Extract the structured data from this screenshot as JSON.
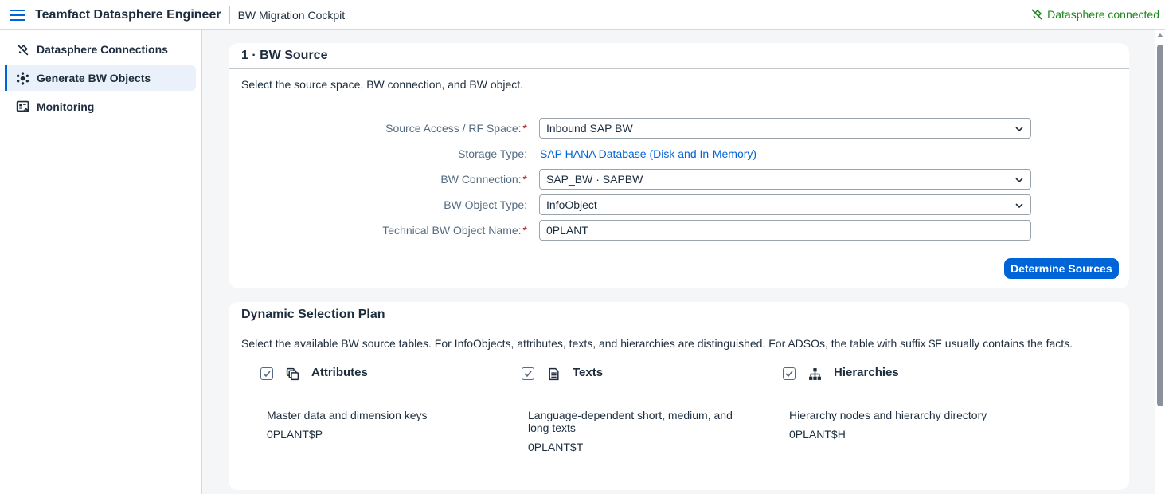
{
  "shell": {
    "title": "Teamfact Datasphere Engineer",
    "subtitle": "BW Migration Cockpit",
    "status": "Datasphere connected",
    "status_color": "#188918",
    "menu_icon": "hamburger-menu-icon"
  },
  "sidebar": {
    "items": [
      {
        "label": "Datasphere Connections",
        "icon": "connection-plug-icon",
        "active": false
      },
      {
        "label": "Generate BW Objects",
        "icon": "cube-network-icon",
        "active": true
      },
      {
        "label": "Monitoring",
        "icon": "monitor-dashboard-icon",
        "active": false
      }
    ]
  },
  "bw_source": {
    "title": "1 · BW Source",
    "description": "Select the source space, BW connection, and BW object.",
    "fields": {
      "source_space": {
        "label": "Source Access / RF Space:",
        "value": "Inbound SAP BW",
        "required": "*"
      },
      "storage_type": {
        "label": "Storage Type:",
        "value": "SAP HANA Database (Disk and In-Memory)"
      },
      "bw_connection": {
        "label": "BW Connection:",
        "value": "SAP_BW · SAPBW",
        "required": "*"
      },
      "bw_object_type": {
        "label": "BW Object Type:",
        "value": "InfoObject"
      },
      "technical_name": {
        "label": "Technical BW Object Name:",
        "value": "0PLANT",
        "required": "*"
      }
    },
    "determine_button": "Determine Sources"
  },
  "selection_plan": {
    "title": "Dynamic Selection Plan",
    "description": "Select the available BW source tables. For InfoObjects, attributes, texts, and hierarchies are distinguished. For ADSOs, the table with suffix $F usually contains the facts.",
    "columns": [
      {
        "title": "Attributes",
        "icon": "attributes-copy-icon",
        "checked": true,
        "description": "Master data and dimension keys",
        "table": "0PLANT$P"
      },
      {
        "title": "Texts",
        "icon": "document-text-icon",
        "checked": true,
        "description": "Language-dependent short, medium, and long texts",
        "table": "0PLANT$T"
      },
      {
        "title": "Hierarchies",
        "icon": "hierarchy-icon",
        "checked": true,
        "description": "Hierarchy nodes and hierarchy directory",
        "table": "0PLANT$H"
      }
    ]
  },
  "colors": {
    "accent": "#0064d9",
    "required": "#aa0808",
    "success": "#188918"
  }
}
